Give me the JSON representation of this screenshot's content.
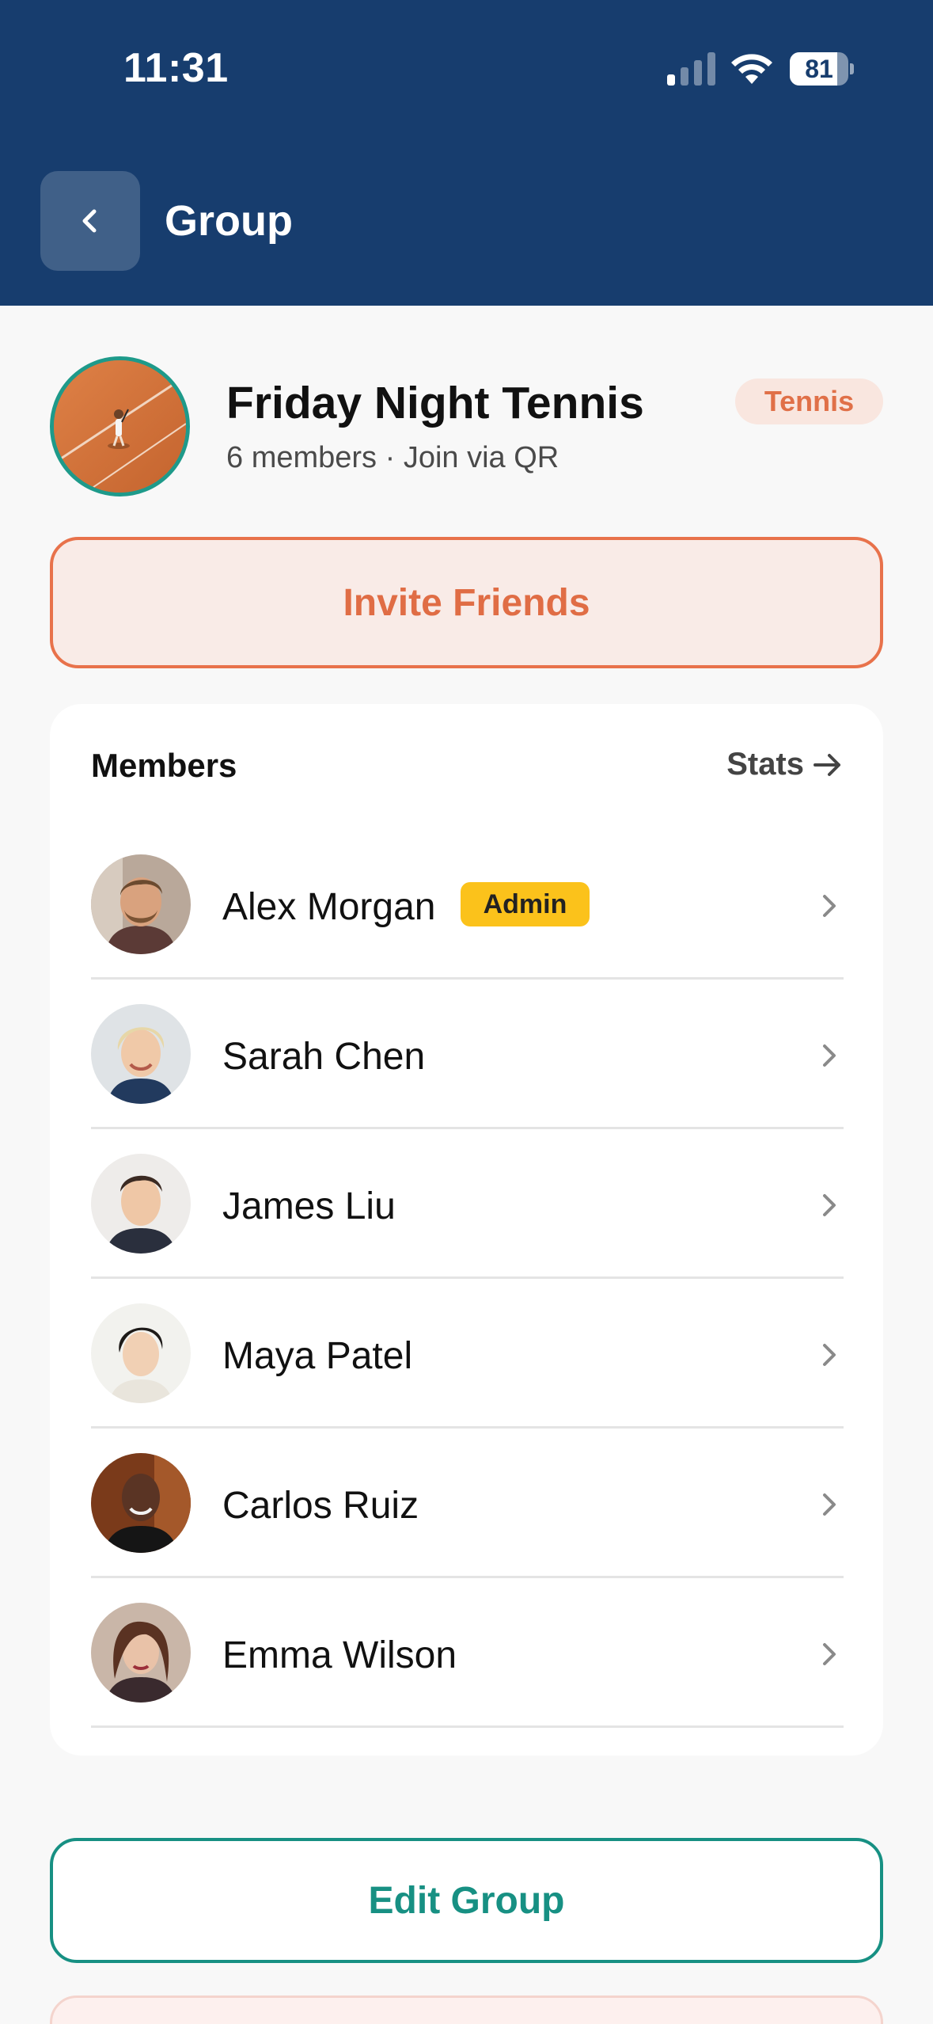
{
  "status_bar": {
    "time": "11:31",
    "battery": "81",
    "battery_level": 0.81
  },
  "header": {
    "title": "Group",
    "back_icon": "chevron-left-icon",
    "background_color": "#173d6e"
  },
  "group": {
    "name": "Friday Night Tennis",
    "meta": "6 members · Join via QR",
    "sport": "Tennis",
    "avatar_icon": "tennis-court-photo"
  },
  "actions": {
    "invite_label": "Invite Friends",
    "edit_label": "Edit Group"
  },
  "members_section": {
    "title": "Members",
    "stats_label": "Stats",
    "members": [
      {
        "name": "Alex Morgan",
        "badge": "Admin"
      },
      {
        "name": "Sarah Chen"
      },
      {
        "name": "James Liu"
      },
      {
        "name": "Maya Patel"
      },
      {
        "name": "Carlos Ruiz"
      },
      {
        "name": "Emma Wilson"
      }
    ]
  },
  "colors": {
    "accent_orange": "#e8724b",
    "accent_teal": "#179083",
    "admin_badge": "#fbc21b"
  }
}
